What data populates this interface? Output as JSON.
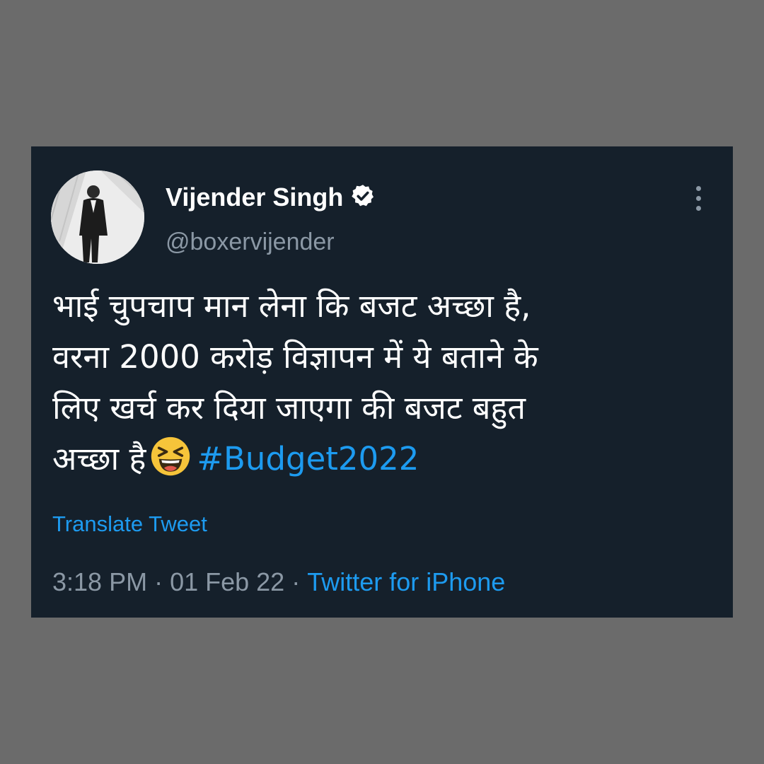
{
  "colors": {
    "page_background": "#6b6b6b",
    "card_background": "#15202b",
    "text_primary": "#ffffff",
    "text_secondary": "#8b98a5",
    "link": "#1d9bf0",
    "emoji": "#f6c43a"
  },
  "tweet": {
    "author": {
      "name": "Vijender Singh",
      "handle": "@boxervijender",
      "verified": true,
      "avatar_icon": "profile-photo"
    },
    "body_lines": [
      "भाई चुपचाप मान लेना कि बजट अच्छा है,",
      "वरना 2000 करोड़ विज्ञापन में ये बताने के",
      "लिए खर्च कर दिया जाएगा की बजट बहुत",
      "अच्छा है"
    ],
    "emoji": "😆",
    "hashtag": "#Budget2022",
    "translate_label": "Translate Tweet",
    "time": "3:18 PM",
    "date": "01 Feb 22",
    "separator": "·",
    "source": "Twitter for iPhone",
    "more_icon": "vertical-ellipsis-icon"
  }
}
